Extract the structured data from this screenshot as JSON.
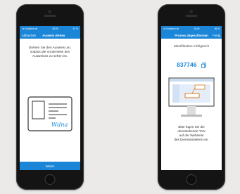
{
  "phones": {
    "left": {
      "status_bar": {
        "carrier": "ıııl Vodafone.de",
        "time": "08:25",
        "battery": "67 %"
      },
      "nav": {
        "cancel_label": "Abbrechen",
        "title": "Ausweis drehen"
      },
      "instruction": "Drehen Sie den Ausweis um, sodass die Vorderseite des Ausweises zu sehen ist.",
      "signature_text": "Wdna",
      "weiter_label": "Weiter"
    },
    "right": {
      "status_bar": {
        "carrier": "ıııl Vodafone.de",
        "time": "08:45",
        "battery": "56 %"
      },
      "nav": {
        "title": "Prozess abgeschlossen",
        "right_label": "Fertig"
      },
      "success_text": "Identifikation erfolgreich",
      "tan": "837746",
      "info_text": [
        "Bitte fügen Sie die",
        "obenstehende TAN",
        "auf der Webseite",
        "des Dienstanbieters ein."
      ]
    }
  },
  "colors": {
    "accent": "#1b86d8",
    "phone_body": "#141414",
    "background": "#ebeae8"
  },
  "icons": [
    "copy-icon",
    "id-card-illustration",
    "monitor-illustration",
    "home-button"
  ]
}
